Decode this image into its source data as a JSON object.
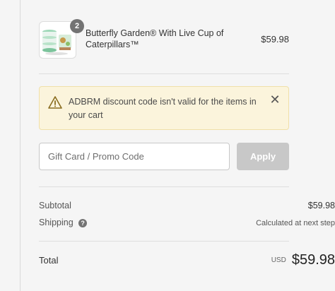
{
  "cart": {
    "item": {
      "name": "Butterfly Garden® With Live Cup of Caterpillars™",
      "quantity": "2",
      "price": "$59.98"
    }
  },
  "alert": {
    "message": "ADBRM discount code isn't valid for the items in your cart"
  },
  "promo": {
    "placeholder": "Gift Card / Promo Code",
    "apply_label": "Apply"
  },
  "summary": {
    "subtotal_label": "Subtotal",
    "subtotal_value": "$59.98",
    "shipping_label": "Shipping",
    "shipping_value": "Calculated at next step",
    "total_label": "Total",
    "currency": "USD",
    "total_value": "$59.98"
  },
  "colors": {
    "alert_bg": "#fbf4dc",
    "alert_border": "#f0e0a8",
    "apply_disabled": "#c8c8c8",
    "badge": "#737373"
  }
}
